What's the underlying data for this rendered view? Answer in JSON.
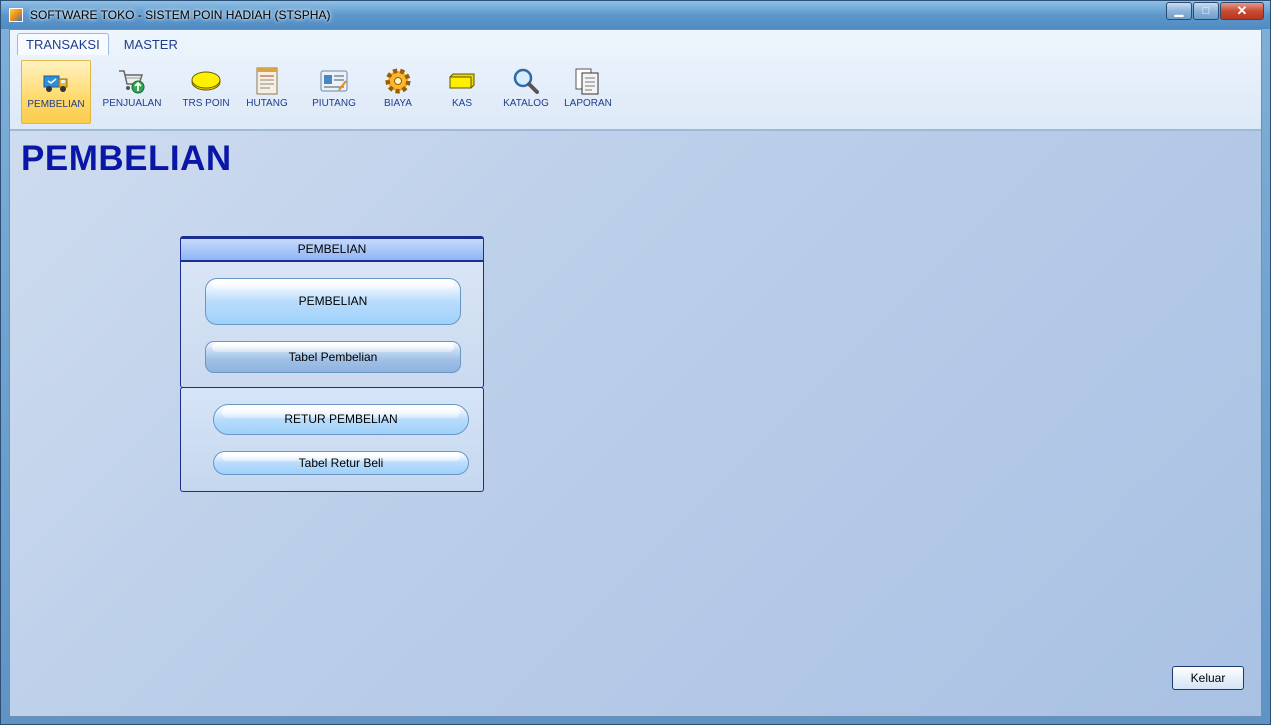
{
  "window": {
    "title": "SOFTWARE TOKO - SISTEM POIN HADIAH (STSPHA)",
    "minimize_glyph": "▁",
    "maximize_glyph": "□",
    "close_glyph": "✕"
  },
  "ribbon": {
    "tabs": [
      {
        "label": "TRANSAKSI",
        "active": true
      },
      {
        "label": "MASTER",
        "active": false
      }
    ],
    "tools": [
      {
        "label": "PEMBELIAN",
        "icon": "delivery-truck-icon",
        "active": true
      },
      {
        "label": "PENJUALAN",
        "icon": "shopping-cart-icon",
        "active": false
      },
      {
        "label": "TRS POIN",
        "icon": "coin-icon",
        "active": false
      },
      {
        "label": "HUTANG",
        "icon": "ledger-icon",
        "active": false
      },
      {
        "label": "PIUTANG",
        "icon": "id-card-icon",
        "active": false
      },
      {
        "label": "BIAYA",
        "icon": "gear-icon",
        "active": false
      },
      {
        "label": "KAS",
        "icon": "cash-bar-icon",
        "active": false
      },
      {
        "label": "KATALOG",
        "icon": "magnifier-icon",
        "active": false
      },
      {
        "label": "LAPORAN",
        "icon": "documents-icon",
        "active": false
      }
    ]
  },
  "main": {
    "page_title": "PEMBELIAN",
    "panel_pembelian": {
      "header": "PEMBELIAN",
      "primary_button": "PEMBELIAN",
      "table_button": "Tabel Pembelian"
    },
    "panel_retur": {
      "primary_button": "RETUR PEMBELIAN",
      "table_button": "Tabel Retur Beli"
    },
    "exit_button": "Keluar"
  },
  "colors": {
    "title_accent": "#0a16a6",
    "active_tool": "#ffd96b",
    "panel_border": "#1a2f8f"
  }
}
